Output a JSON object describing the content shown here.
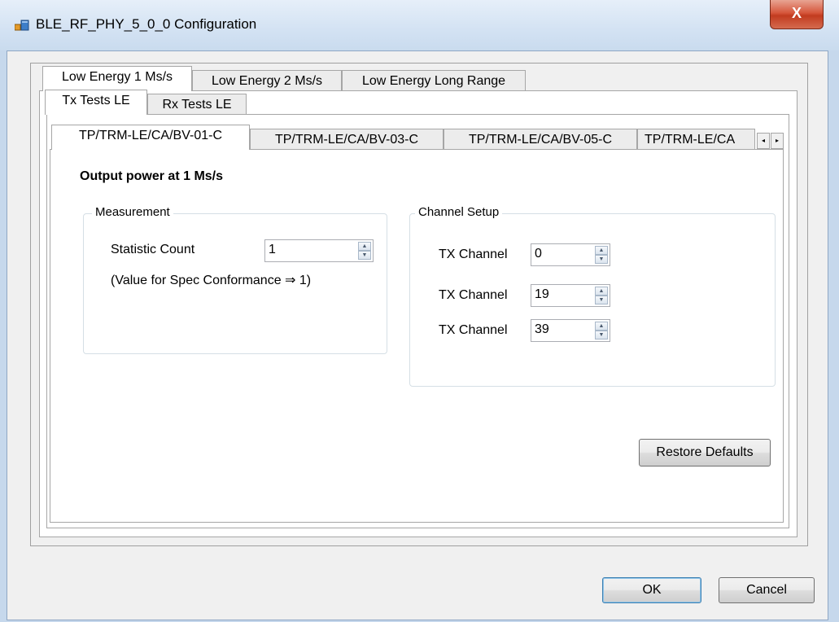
{
  "window": {
    "title": "BLE_RF_PHY_5_0_0 Configuration",
    "close_glyph": "X"
  },
  "tabs_level1": [
    {
      "label": "Low Energy 1 Ms/s",
      "selected": true
    },
    {
      "label": "Low Energy 2 Ms/s",
      "selected": false
    },
    {
      "label": "Low Energy Long Range",
      "selected": false
    }
  ],
  "tabs_level2": [
    {
      "label": "Tx Tests LE",
      "selected": true
    },
    {
      "label": "Rx Tests LE",
      "selected": false
    }
  ],
  "tabs_level3": [
    {
      "label": "TP/TRM-LE/CA/BV-01-C",
      "selected": true
    },
    {
      "label": "TP/TRM-LE/CA/BV-03-C",
      "selected": false
    },
    {
      "label": "TP/TRM-LE/CA/BV-05-C",
      "selected": false
    },
    {
      "label": "TP/TRM-LE/CA",
      "selected": false
    }
  ],
  "tab_scroll": {
    "left_icon": "◂",
    "right_icon": "▸"
  },
  "content": {
    "heading": "Output power at 1 Ms/s",
    "measurement": {
      "group_label": "Measurement",
      "statistic_count_label": "Statistic Count",
      "statistic_count_value": "1",
      "note": "(Value for Spec Conformance ⇒ 1)"
    },
    "channel_setup": {
      "group_label": "Channel Setup",
      "channels": [
        {
          "label": "TX Channel",
          "value": "0"
        },
        {
          "label": "TX Channel",
          "value": "19"
        },
        {
          "label": "TX Channel",
          "value": "39"
        }
      ]
    },
    "restore_defaults_label": "Restore Defaults"
  },
  "footer": {
    "ok_label": "OK",
    "cancel_label": "Cancel"
  },
  "spinner_icons": {
    "up": "▲",
    "down": "▼"
  }
}
